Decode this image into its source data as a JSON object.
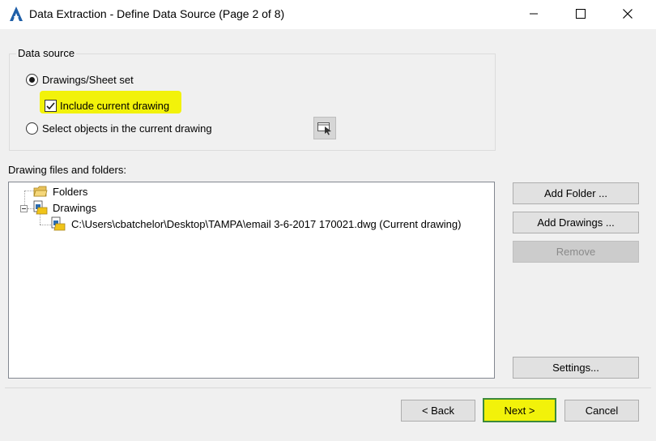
{
  "window": {
    "title": "Data Extraction - Define Data Source (Page 2 of 8)",
    "controls": {
      "minimize": "minimize-icon",
      "maximize": "maximize-icon",
      "close": "close-icon"
    }
  },
  "data_source": {
    "group_label": "Data source",
    "option_drawings": "Drawings/Sheet set",
    "option_drawings_selected": true,
    "include_current": "Include current drawing",
    "include_current_checked": true,
    "option_select_objects": "Select objects in the current drawing",
    "option_select_objects_selected": false,
    "select_objects_button_icon": "select-objects-icon"
  },
  "files": {
    "label": "Drawing files and folders:",
    "tree": {
      "folders": "Folders",
      "drawings": "Drawings",
      "drawing_item": "C:\\Users\\cbatchelor\\Desktop\\TAMPA\\email 3-6-2017 170021.dwg (Current drawing)"
    }
  },
  "side_buttons": {
    "add_folder": "Add Folder ...",
    "add_drawings": "Add Drawings ...",
    "remove": "Remove",
    "settings": "Settings..."
  },
  "footer": {
    "back": "< Back",
    "next": "Next >",
    "cancel": "Cancel"
  },
  "colors": {
    "highlight": "#f2f20a",
    "titlebar": "#ffffff",
    "dialog_bg": "#f0f0f0"
  }
}
